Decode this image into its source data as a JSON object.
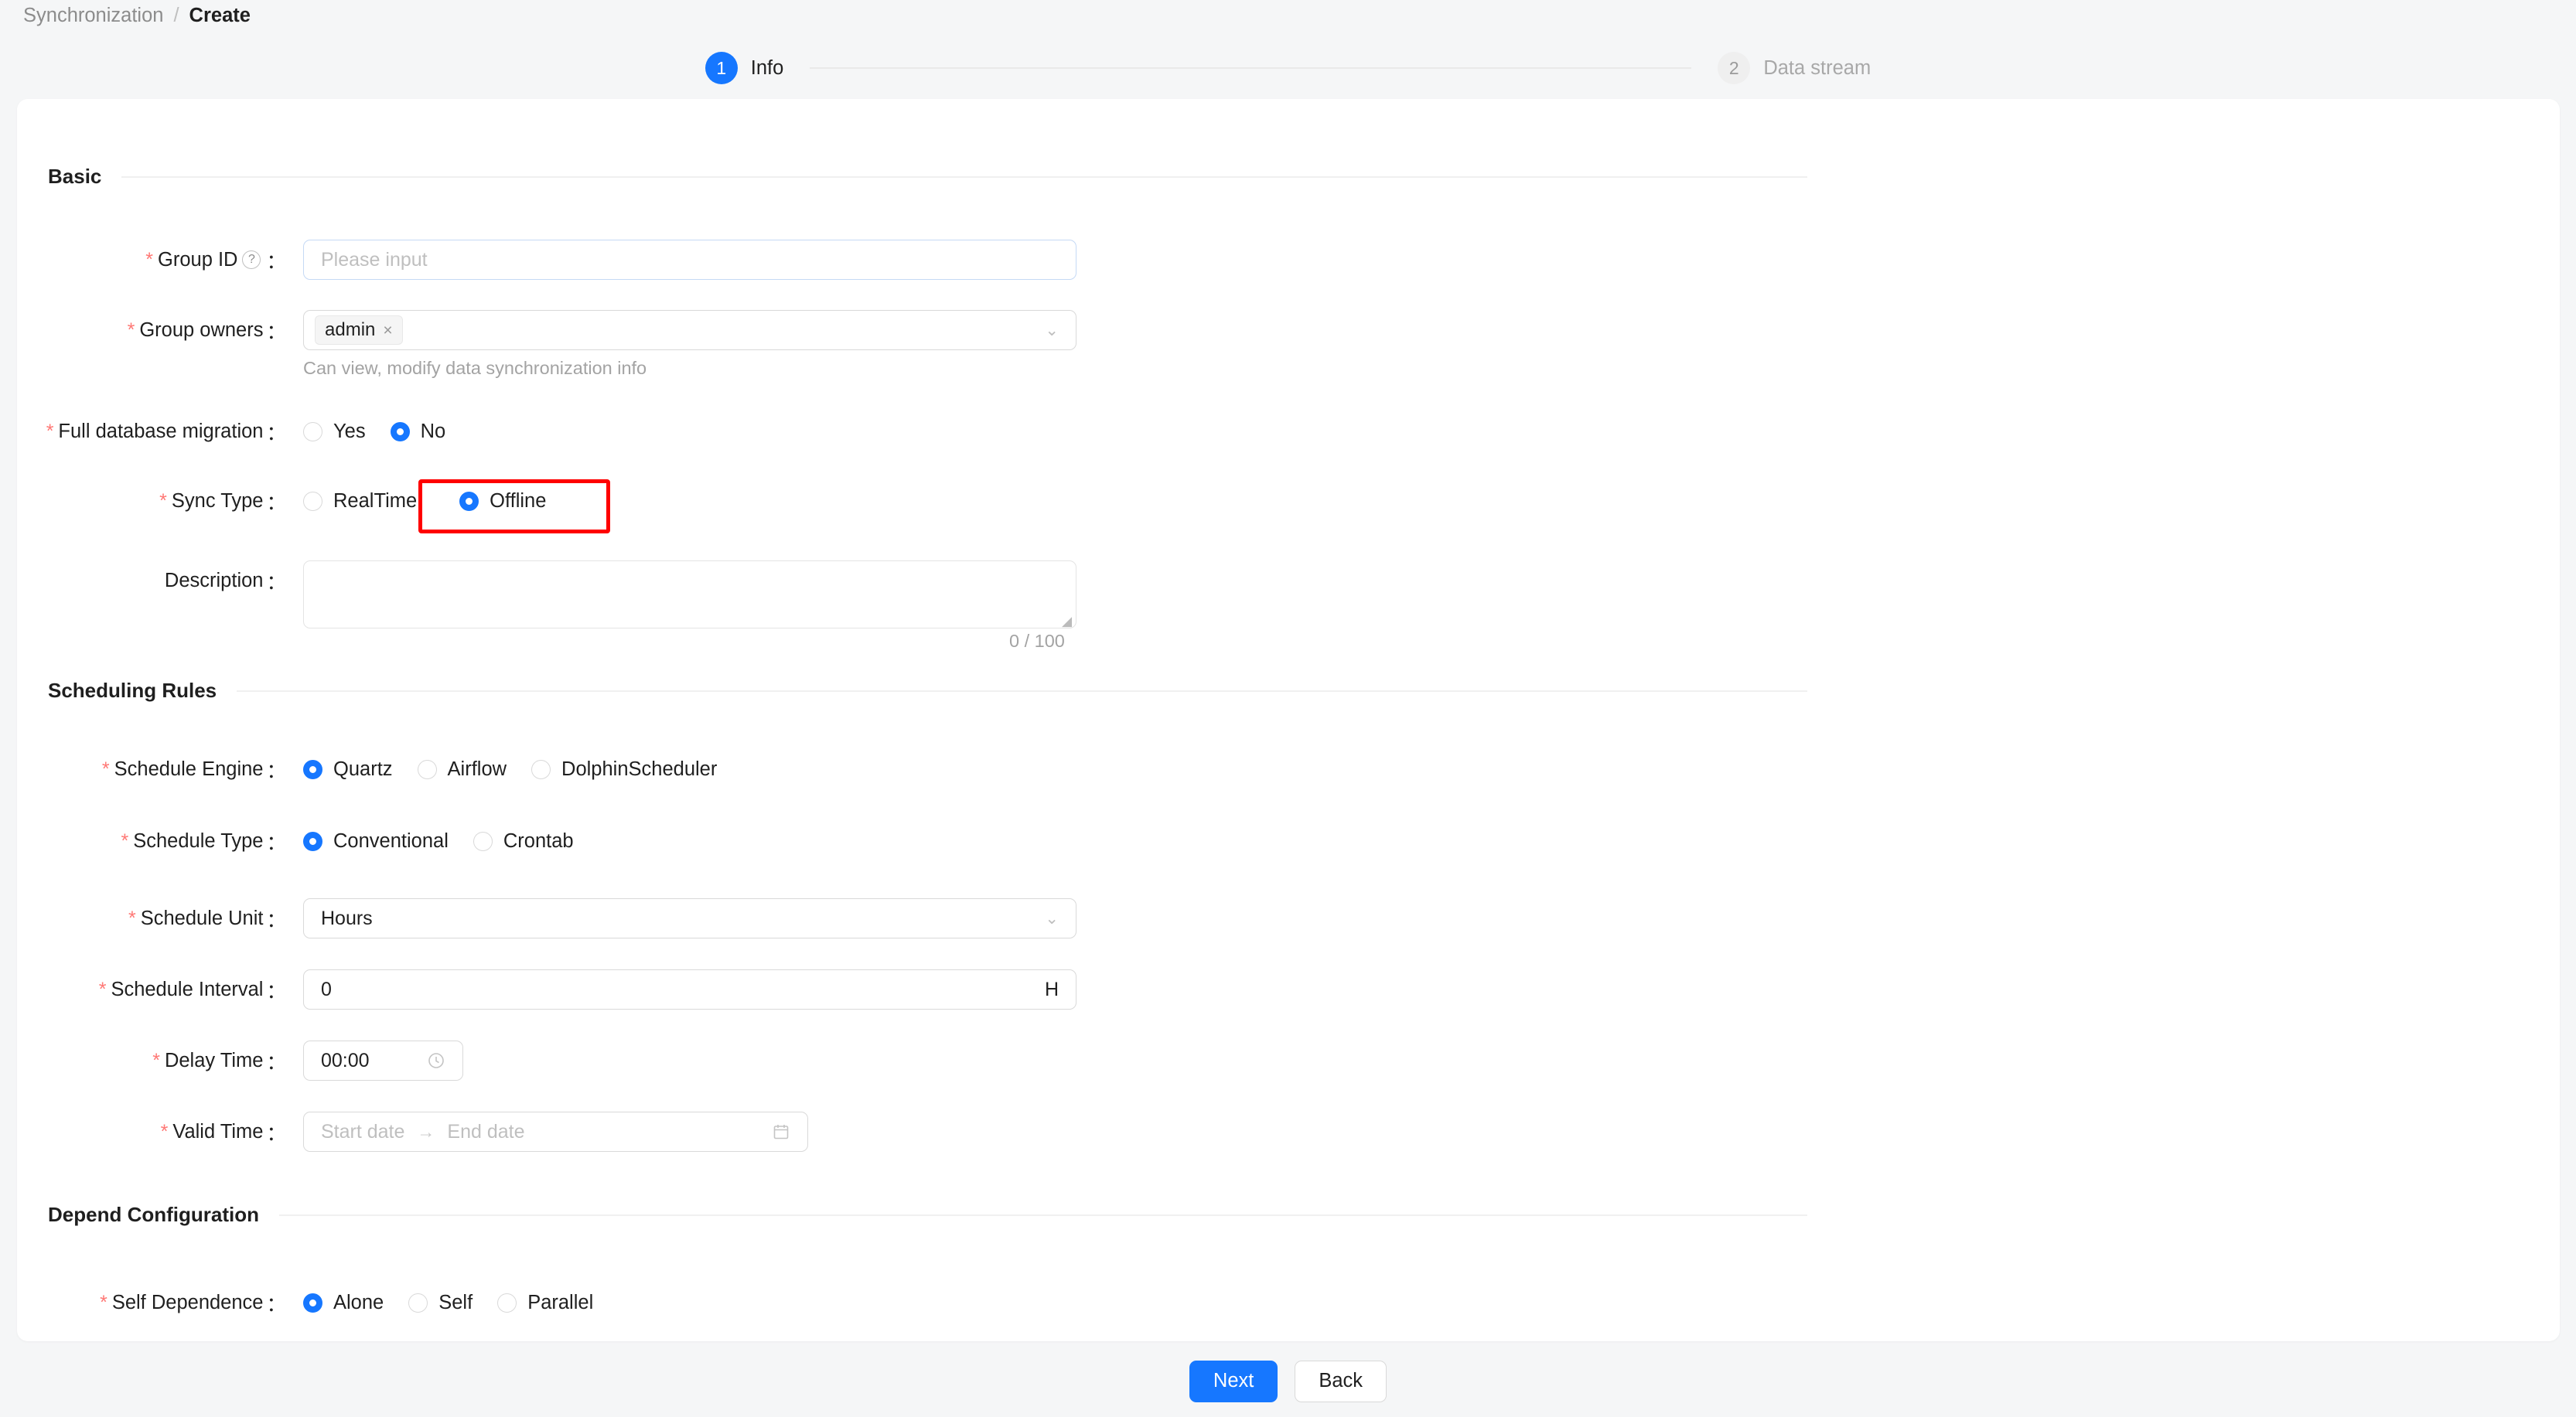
{
  "breadcrumb": {
    "parent": "Synchronization",
    "separator": "/",
    "current": "Create"
  },
  "stepper": {
    "steps": [
      {
        "number": "1",
        "label": "Info",
        "state": "active"
      },
      {
        "number": "2",
        "label": "Data stream",
        "state": "idle"
      }
    ],
    "active_color": "#1677ff",
    "idle_color": "#efefef"
  },
  "sections": {
    "basic": {
      "title": "Basic"
    },
    "scheduling": {
      "title": "Scheduling Rules"
    },
    "depend": {
      "title": "Depend Configuration"
    }
  },
  "fields": {
    "group_id": {
      "label": "Group ID",
      "required": true,
      "help_icon": "question-circle-icon",
      "colon": "：",
      "placeholder": "Please input",
      "value": ""
    },
    "group_owners": {
      "label": "Group owners",
      "required": true,
      "colon": "：",
      "tags": [
        {
          "text": "admin",
          "close": "×"
        }
      ],
      "caret": "chevron-down-icon",
      "hint": "Can view, modify data synchronization info"
    },
    "full_database_migration": {
      "label": "Full database migration",
      "required": true,
      "colon": "：",
      "options": [
        {
          "label": "Yes",
          "selected": false
        },
        {
          "label": "No",
          "selected": true
        }
      ]
    },
    "sync_type": {
      "label": "Sync Type",
      "required": true,
      "colon": "：",
      "options": [
        {
          "label": "RealTime",
          "selected": false
        },
        {
          "label": "Offline",
          "selected": true
        }
      ],
      "annotation": {
        "color": "#ff0000",
        "target": "Offline"
      }
    },
    "description": {
      "label": "Description",
      "required": false,
      "colon": "：",
      "value": "",
      "counter": "0 / 100"
    },
    "schedule_engine": {
      "label": "Schedule Engine",
      "required": true,
      "colon": "：",
      "options": [
        {
          "label": "Quartz",
          "selected": true
        },
        {
          "label": "Airflow",
          "selected": false
        },
        {
          "label": "DolphinScheduler",
          "selected": false
        }
      ]
    },
    "schedule_type": {
      "label": "Schedule Type",
      "required": true,
      "colon": "：",
      "options": [
        {
          "label": "Conventional",
          "selected": true
        },
        {
          "label": "Crontab",
          "selected": false
        }
      ]
    },
    "schedule_unit": {
      "label": "Schedule Unit",
      "required": true,
      "colon": "：",
      "value": "Hours",
      "caret": "chevron-down-icon"
    },
    "schedule_interval": {
      "label": "Schedule Interval",
      "required": true,
      "colon": "：",
      "value": "0",
      "suffix": "H"
    },
    "delay_time": {
      "label": "Delay Time",
      "required": true,
      "colon": "：",
      "value": "00:00",
      "icon": "clock-icon"
    },
    "valid_time": {
      "label": "Valid Time",
      "required": true,
      "colon": "：",
      "start_placeholder": "Start date",
      "range_arrow": "→",
      "end_placeholder": "End date",
      "icon": "calendar-icon"
    },
    "self_dependence": {
      "label": "Self Dependence",
      "required": true,
      "colon": "：",
      "options": [
        {
          "label": "Alone",
          "selected": true
        },
        {
          "label": "Self",
          "selected": false
        },
        {
          "label": "Parallel",
          "selected": false
        }
      ]
    }
  },
  "footer": {
    "next_label": "Next",
    "back_label": "Back"
  }
}
